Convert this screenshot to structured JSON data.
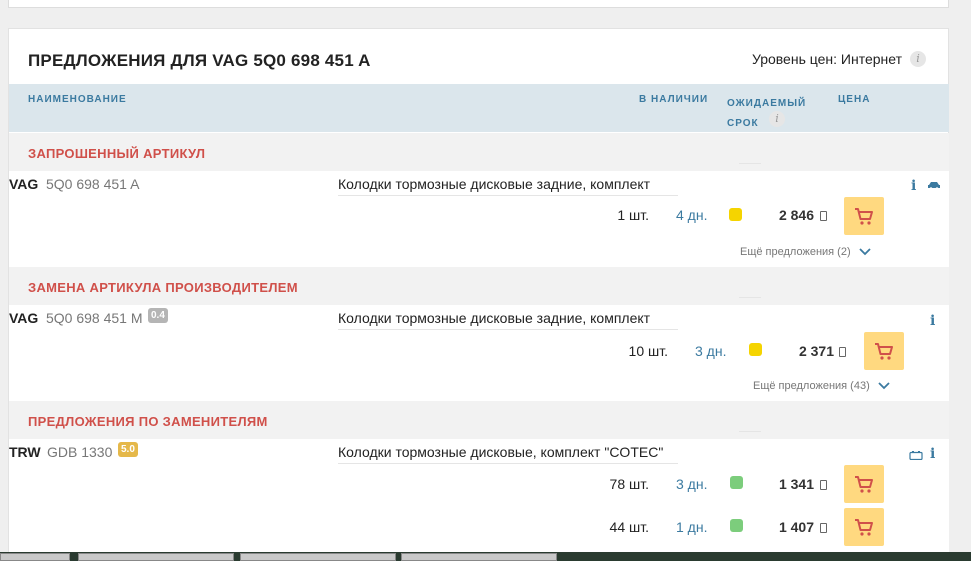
{
  "header": {
    "title": "ПРЕДЛОЖЕНИЯ ДЛЯ VAG 5Q0 698 451 A",
    "price_level_label": "Уровень цен: Интернет"
  },
  "columns": {
    "name": "НАИМЕНОВАНИЕ",
    "stock": "В НАЛИЧИИ",
    "eta_line1": "ОЖИДАЕМЫЙ",
    "eta_line2": "СРОК",
    "price": "ЦЕНА"
  },
  "sections": [
    {
      "title": "ЗАПРОШЕННЫЙ АРТИКУЛ",
      "brand": "VAG",
      "article": "5Q0 698 451 A",
      "description": "Колодки тормозные дисковые задние, комплект",
      "offers": [
        {
          "qty": "1 шт.",
          "days": "4 дн.",
          "status_color": "#f5d400",
          "price": "2 846"
        }
      ],
      "more": "Ещё предложения (2)"
    },
    {
      "title": "ЗАМЕНА АРТИКУЛА ПРОИЗВОДИТЕЛЕМ",
      "brand": "VAG",
      "article": "5Q0 698 451 M",
      "rating": "0.4",
      "description": "Колодки тормозные дисковые задние, комплект",
      "offers": [
        {
          "qty": "10 шт.",
          "days": "3 дн.",
          "status_color": "#f5d400",
          "price": "2 371"
        }
      ],
      "more": "Ещё предложения (43)"
    },
    {
      "title": "ПРЕДЛОЖЕНИЯ ПО ЗАМЕНИТЕЛЯМ",
      "brand": "TRW",
      "article": "GDB 1330",
      "rating": "5.0",
      "description": "Колодки тормозные дисковые, комплект \"COTEC\"",
      "offers": [
        {
          "qty": "78 шт.",
          "days": "3 дн.",
          "status_color": "#7ccd7c",
          "price": "1 341"
        },
        {
          "qty": "44 шт.",
          "days": "1 дн.",
          "status_color": "#7ccd7c",
          "price": "1 407"
        }
      ]
    }
  ],
  "colors": {
    "accent_blue": "#3b7aa0",
    "section_red": "#d0504a",
    "cart_yellow": "#ffd980",
    "header_bg": "#dbe6ec",
    "badge_gray": "#b5b5b5",
    "badge_gold": "#e5b84a"
  },
  "icons": {
    "info": "info-icon",
    "car": "car-icon",
    "battery": "battery-icon",
    "cart": "cart-icon",
    "chevron": "chevron-down-icon"
  }
}
